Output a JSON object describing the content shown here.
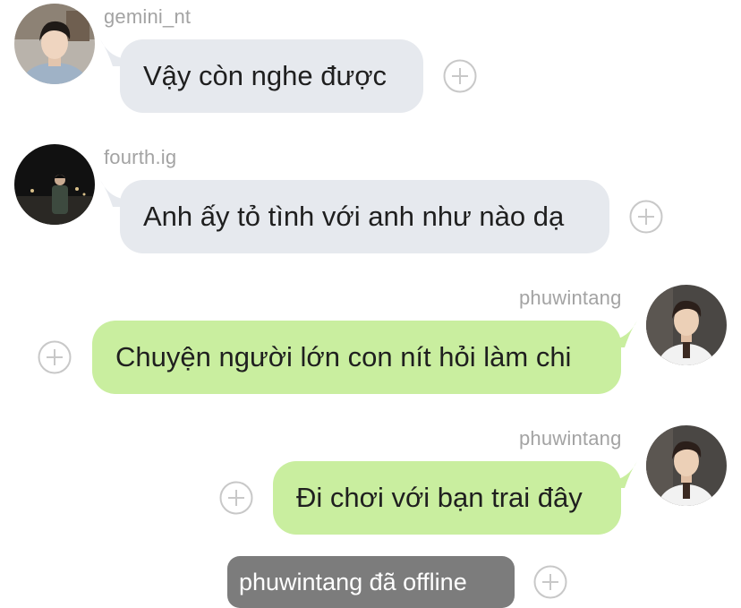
{
  "colors": {
    "incoming_bubble": "#e6e9ee",
    "outgoing_bubble": "#c9ee9f",
    "username": "#a3a3a3",
    "system_badge": "#7c7c7c",
    "plus_icon": "#c8c8c8"
  },
  "messages": [
    {
      "sender": "gemini_nt",
      "text": "Vậy còn nghe được",
      "direction": "incoming"
    },
    {
      "sender": "fourth.ig",
      "text": "Anh ấy tỏ tình với anh như nào dạ",
      "direction": "incoming"
    },
    {
      "sender": "phuwintang",
      "text": "Chuyện người lớn con nít hỏi làm chi",
      "direction": "outgoing"
    },
    {
      "sender": "phuwintang",
      "text": "Đi chơi với bạn trai đây",
      "direction": "outgoing"
    }
  ],
  "system_message": {
    "text": "phuwintang đã offline"
  },
  "icons": {
    "reaction": "plus-circle-icon",
    "avatar": "profile-photo"
  }
}
